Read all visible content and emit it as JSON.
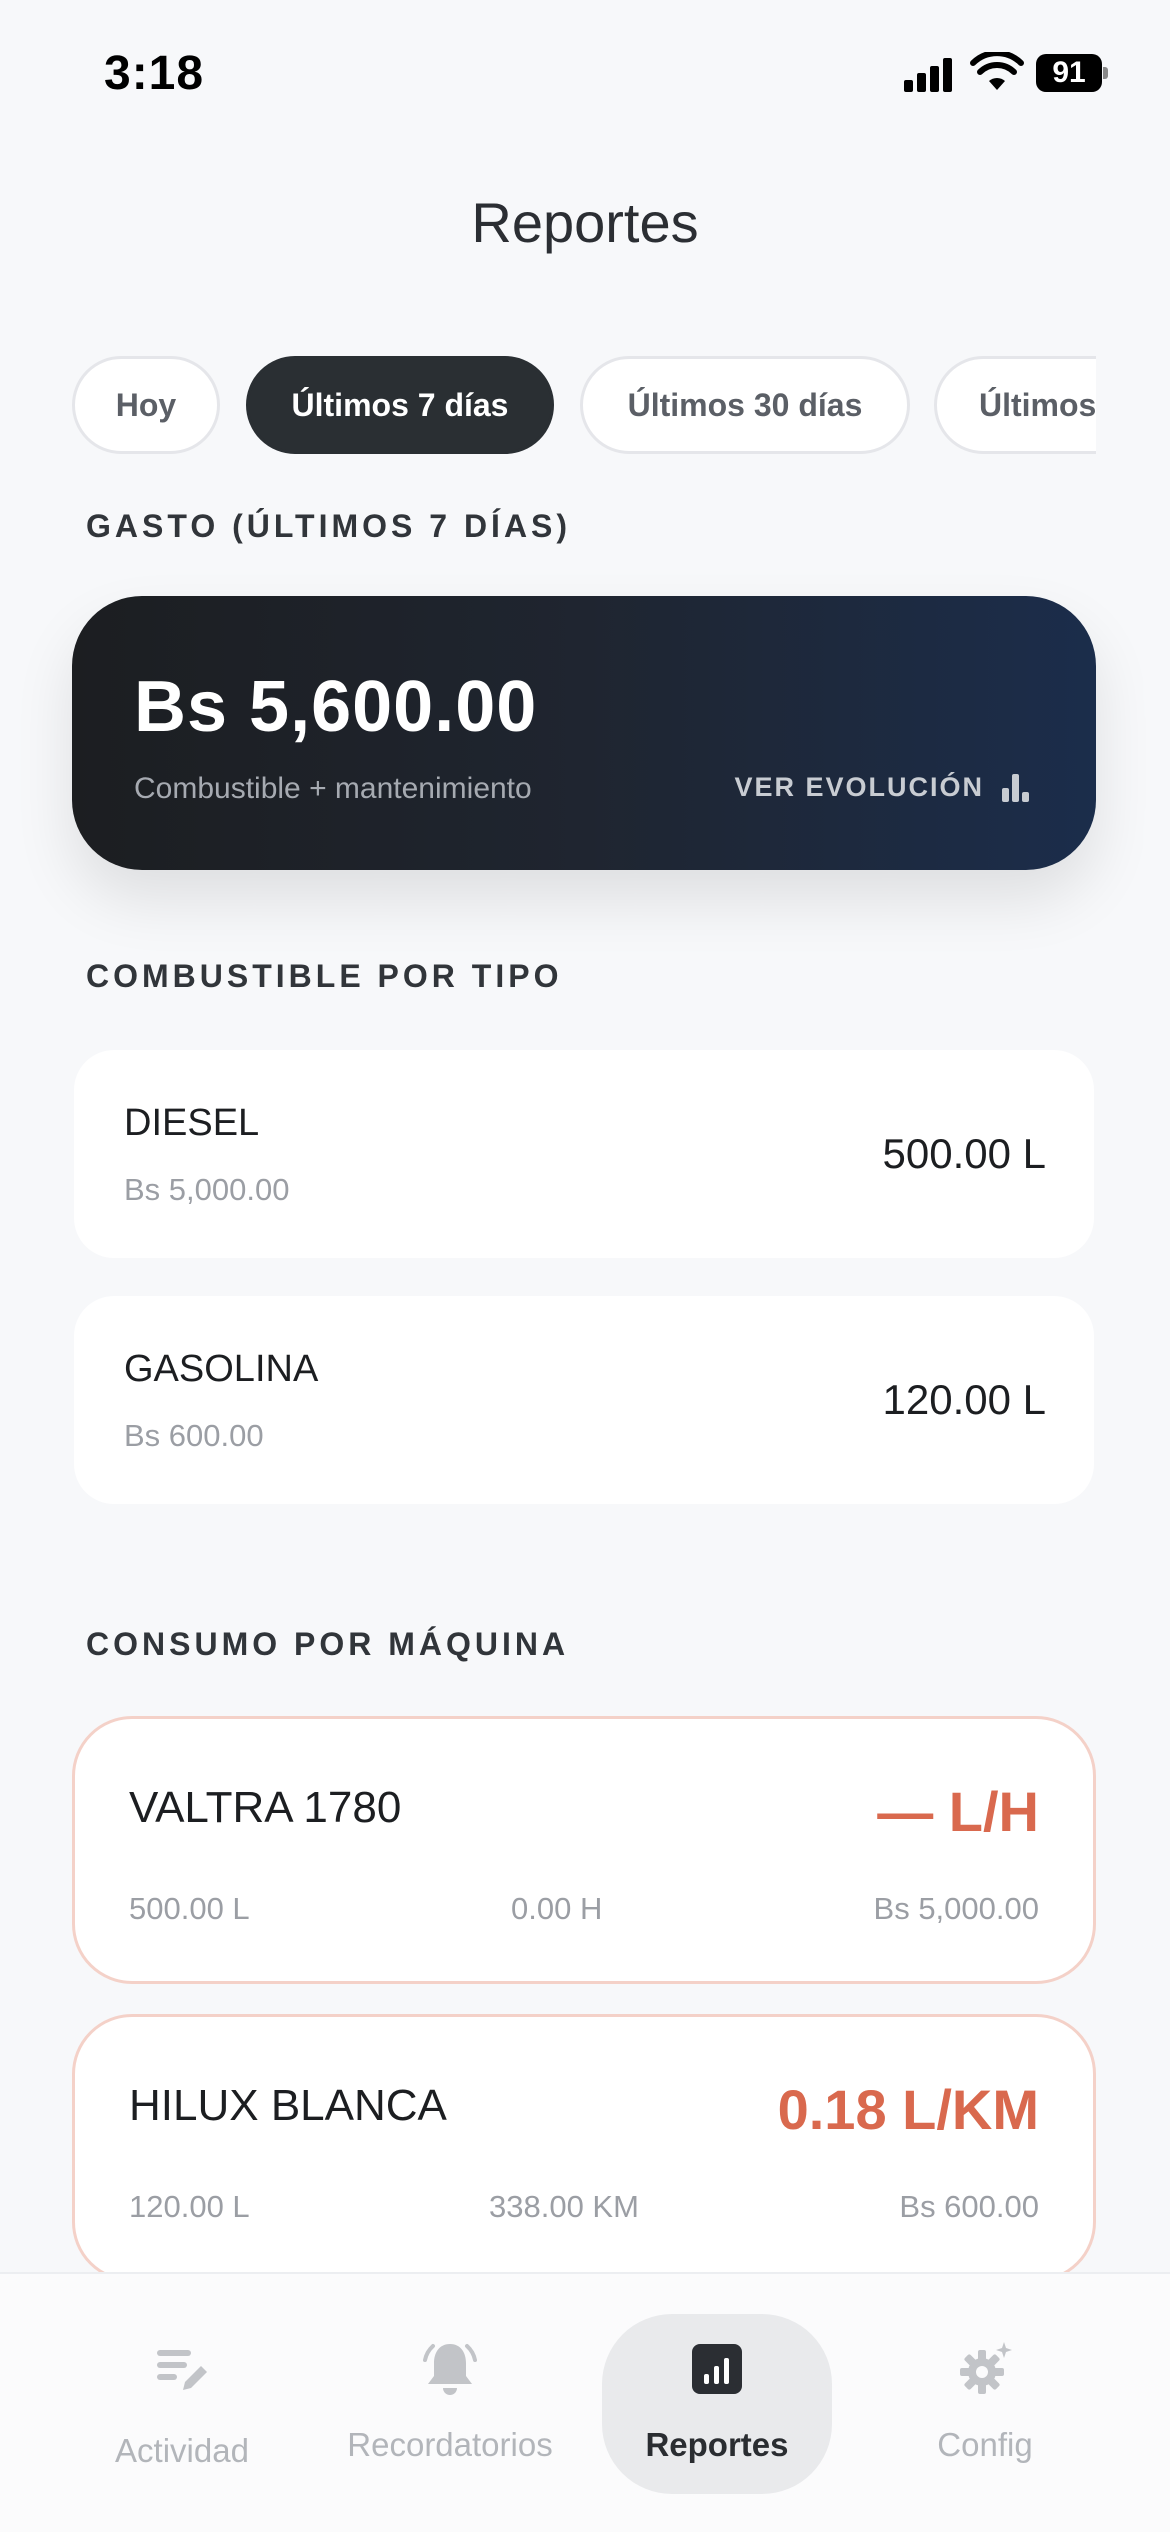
{
  "status_bar": {
    "time": "3:18",
    "battery": "91"
  },
  "header": {
    "title": "Reportes"
  },
  "filters": [
    {
      "label": "Hoy",
      "active": false
    },
    {
      "label": "Últimos 7 días",
      "active": true
    },
    {
      "label": "Últimos 30 días",
      "active": false
    },
    {
      "label": "Últimos",
      "active": false
    }
  ],
  "summary": {
    "section_label": "GASTO (ÚLTIMOS 7 DÍAS)",
    "amount": "Bs 5,600.00",
    "subtitle": "Combustible + mantenimiento",
    "link_label": "VER EVOLUCIÓN"
  },
  "fuel_section": {
    "label": "COMBUSTIBLE POR TIPO",
    "items": [
      {
        "name": "DIESEL",
        "cost": "Bs 5,000.00",
        "liters": "500.00 L"
      },
      {
        "name": "GASOLINA",
        "cost": "Bs 600.00",
        "liters": "120.00 L"
      }
    ]
  },
  "machine_section": {
    "label": "CONSUMO POR MÁQUINA",
    "items": [
      {
        "name": "VALTRA 1780",
        "rate": "— L/H",
        "liters": "500.00 L",
        "usage": "0.00 H",
        "cost": "Bs 5,000.00"
      },
      {
        "name": "HILUX BLANCA",
        "rate": "0.18 L/KM",
        "liters": "120.00 L",
        "usage": "338.00 KM",
        "cost": "Bs 600.00"
      }
    ]
  },
  "bottom_nav": [
    {
      "label": "Actividad",
      "icon": "edit-list-icon",
      "active": false
    },
    {
      "label": "Recordatorios",
      "icon": "bell-icon",
      "active": false
    },
    {
      "label": "Reportes",
      "icon": "chart-icon",
      "active": true
    },
    {
      "label": "Config",
      "icon": "gear-icon",
      "active": false
    }
  ],
  "colors": {
    "accent": "#d9694e",
    "dark": "#2a2f33",
    "hero_end": "#1b2d4b"
  }
}
